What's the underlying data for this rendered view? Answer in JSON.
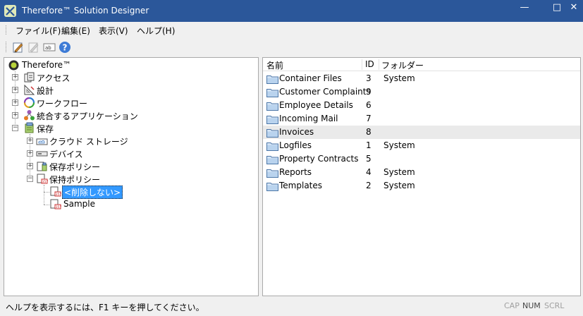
{
  "window": {
    "title": "Therefore™ Solution Designer"
  },
  "menu": [
    "ファイル(F)",
    "編集(E)",
    "表示(V)",
    "ヘルプ(H)"
  ],
  "toolbar": {
    "buttons": [
      {
        "icon": "edit-icon"
      },
      {
        "icon": "edit-disabled-icon"
      },
      {
        "icon": "rename-icon"
      },
      {
        "icon": "help-icon",
        "label": "?"
      }
    ],
    "rename_label": "ab"
  },
  "tree": {
    "root": "Therefore™",
    "nodes": [
      {
        "label": "アクセス",
        "icon": "access-icon"
      },
      {
        "label": "設計",
        "icon": "design-icon"
      },
      {
        "label": "ワークフロー",
        "icon": "workflow-icon"
      },
      {
        "label": "統合するアプリケーション",
        "icon": "integration-icon"
      },
      {
        "label": "保存",
        "icon": "storage-icon"
      }
    ],
    "storage_children": [
      {
        "label": "クラウド ストレージ",
        "icon": "cloud-storage-icon"
      },
      {
        "label": "デバイス",
        "icon": "device-icon"
      },
      {
        "label": "保存ポリシー",
        "icon": "storage-policy-icon"
      },
      {
        "label": "保持ポリシー",
        "icon": "retention-policy-icon"
      }
    ],
    "retention_children": [
      {
        "label": "<削除しない>",
        "selected": true
      },
      {
        "label": "Sample",
        "selected": false
      }
    ]
  },
  "list": {
    "columns": [
      "名前",
      "ID",
      "フォルダー"
    ],
    "rows": [
      {
        "name": "Container Files",
        "id": "3",
        "folder": "System"
      },
      {
        "name": "Customer Complaints",
        "id": "9",
        "folder": ""
      },
      {
        "name": "Employee Details",
        "id": "6",
        "folder": ""
      },
      {
        "name": "Incoming Mail",
        "id": "7",
        "folder": ""
      },
      {
        "name": "Invoices",
        "id": "8",
        "folder": ""
      },
      {
        "name": "Logfiles",
        "id": "1",
        "folder": "System"
      },
      {
        "name": "Property Contracts",
        "id": "5",
        "folder": ""
      },
      {
        "name": "Reports",
        "id": "4",
        "folder": "System"
      },
      {
        "name": "Templates",
        "id": "2",
        "folder": "System"
      }
    ],
    "highlighted_row": 4
  },
  "status": {
    "message": "ヘルプを表示するには、F1 キーを押してください。",
    "cap": "CAP",
    "num": "NUM",
    "scrl": "SCRL"
  },
  "colors": {
    "titlebar": "#2b579a",
    "selection": "#3399ff"
  }
}
